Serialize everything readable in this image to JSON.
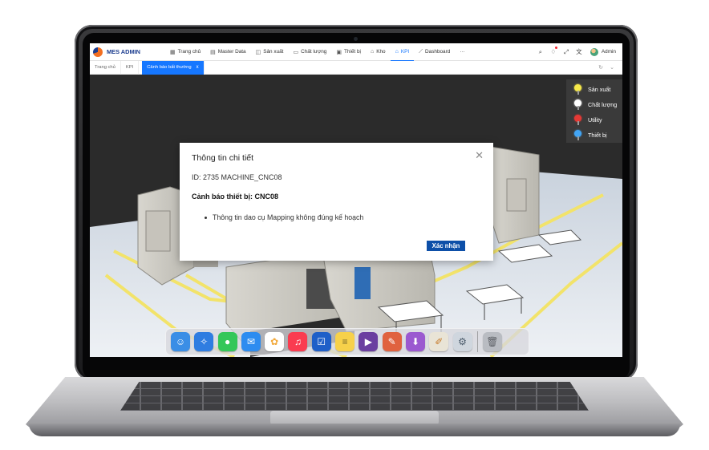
{
  "app": {
    "brand_name": "MES ADMIN",
    "brand_colors": {
      "orange": "#f36f21",
      "navy": "#1c3d8f"
    },
    "accent_color": "#1677ff"
  },
  "nav": {
    "items": [
      {
        "label": "Trang chủ",
        "icon": "grid-icon"
      },
      {
        "label": "Master Data",
        "icon": "document-icon"
      },
      {
        "label": "Sản xuất",
        "icon": "layers-icon"
      },
      {
        "label": "Chất lượng",
        "icon": "monitor-icon"
      },
      {
        "label": "Thiết bị",
        "icon": "printer-icon"
      },
      {
        "label": "Kho",
        "icon": "box-icon"
      },
      {
        "label": "KPI",
        "icon": "home-icon",
        "active": true
      },
      {
        "label": "Dashboard",
        "icon": "line-chart-icon"
      },
      {
        "label": "···",
        "icon": "more-icon"
      }
    ],
    "user": {
      "name": "Admin"
    }
  },
  "tabs": {
    "items": [
      {
        "label": "Trang chủ"
      },
      {
        "label": "KPI"
      },
      {
        "label": "Cảnh báo bất thường",
        "active": true,
        "close": "x"
      }
    ]
  },
  "legend": {
    "items": [
      {
        "label": "Sản xuất",
        "color": "#f7e94a"
      },
      {
        "label": "Chất lượng",
        "color": "#ffffff"
      },
      {
        "label": "Utility",
        "color": "#e53935"
      },
      {
        "label": "Thiết bị",
        "color": "#42a5f5"
      }
    ]
  },
  "modal": {
    "title": "Thông tin chi tiết",
    "id_line": "ID: 2735 MACHINE_CNC08",
    "warning": "Cảnh báo thiết bị: CNC08",
    "items": [
      "Thông tin dao cụ Mapping không đúng kế hoạch"
    ],
    "confirm_label": "Xác nhận"
  },
  "dock": {
    "apps": [
      {
        "name": "finder-icon",
        "color": "#3a8ee6"
      },
      {
        "name": "safari-icon",
        "color": "#2f7de1"
      },
      {
        "name": "messages-icon",
        "color": "#34c759"
      },
      {
        "name": "mail-icon",
        "color": "#2d8cf0"
      },
      {
        "name": "photos-icon",
        "color": "#f2a93b"
      },
      {
        "name": "music-icon",
        "color": "#fa3c50"
      },
      {
        "name": "tasks-icon",
        "color": "#1f5fc8"
      },
      {
        "name": "notes-icon",
        "color": "#f7d14a"
      },
      {
        "name": "video-editor-icon",
        "color": "#6b3fa0"
      },
      {
        "name": "pixelmator-icon",
        "color": "#e0623f"
      },
      {
        "name": "downloads-icon",
        "color": "#9b59d0"
      },
      {
        "name": "script-editor-icon",
        "color": "#e9e4d6"
      },
      {
        "name": "preview-icon",
        "color": "#cfd6de"
      },
      {
        "name": "trash-icon",
        "color": "#b9bcc2"
      }
    ]
  }
}
